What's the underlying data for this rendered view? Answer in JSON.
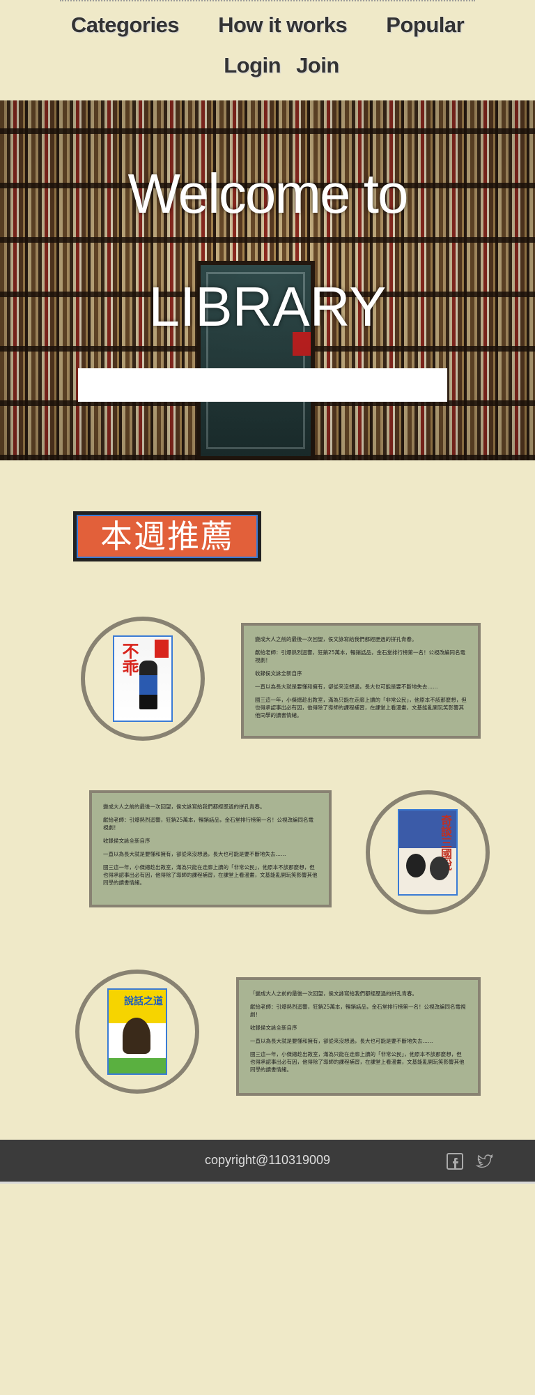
{
  "nav": {
    "items": [
      "Categories",
      "How it works",
      "Popular",
      "Login",
      "Join"
    ]
  },
  "hero": {
    "title_line1": "Welcome to",
    "title_line2": "LIBRARY",
    "search_placeholder": ""
  },
  "section": {
    "badge": "本週推薦"
  },
  "books": [
    {
      "cover_title": "不乖",
      "description": [
        "變成大人之前的最後一次回望，侯文詠寫給我們都經歷過的拼孔青春。",
        "獻給老師：引爆熱烈迴響，狂銷25萬本，暢銷話品，金石堂排行榜第一名！公視改編同名電視劇！",
        "收錄侯文詠全新自序",
        "一直以為長大就是要懂和擁有，卻從來沒想過，長大也可能是要不斷地失去……",
        "國三這一年，小傑總趁出教室，滿為只能在走廊上讀的「非常公民」，他原本不該那麼想，但也得承認事出必有因，他得除了導師的課程補習，在課堂上看漫畫，文基能亂開玩笑影響其他同學的讀書情緒。"
      ]
    },
    {
      "cover_title": "奇談三國說",
      "description": [
        "變成大人之前的最後一次回望，侯文詠寫給我們都經歷過的拼孔青春。",
        "獻給老師：引爆熱烈迴響，狂銷25萬本，暢銷話品，金石堂排行榜第一名！公視改編同名電視劇！",
        "收錄侯文詠全新自序",
        "一直以為長大就是要懂和擁有，卻從來沒想過，長大也可能是要不斷地失去……",
        "國三這一年，小傑總趁出教室，滿為只能在走廊上讀的「非常公民」，他原本不該那麼想，但也得承認事出必有因，他得除了導師的課程補習，在課堂上看漫畫，文基能亂開玩笑影響其他同學的讀書情緒。"
      ]
    },
    {
      "cover_title": "說話之道",
      "description": [
        "「變成大人之前的最後一次回望，侯文詠寫給我們都經歷過的拼孔青春。",
        "獻給老師：引爆熱烈迴響，狂銷25萬本，暢銷話品，金石堂排行榜第一名！公視改編同名電視劇！",
        "收錄侯文詠全新自序",
        "一直以為長大就是要懂和擁有，卻從來沒想過，長大也可能是要不斷地失去……",
        "國三這一年，小傑總趁出教室，滿為只能在走廊上讀的「非常公民」，他原本不該那麼想，但也得承認事出必有因，他得除了導師的課程補習，在課堂上看漫畫，文基能亂開玩笑影響其他同學的讀書情緒。"
      ]
    }
  ],
  "footer": {
    "copyright": "copyright@110319009",
    "social": [
      "facebook-icon",
      "twitter-icon"
    ]
  }
}
